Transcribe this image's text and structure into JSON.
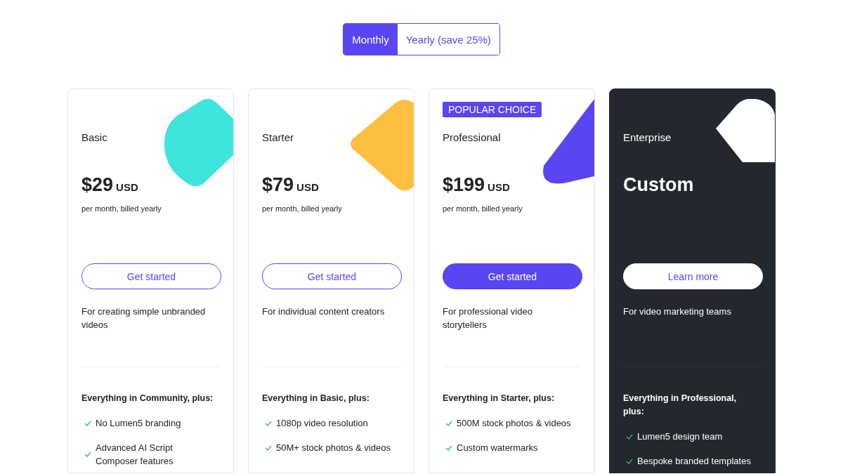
{
  "billing_toggle": [
    {
      "label": "Monthly",
      "selected": true
    },
    {
      "label": "Yearly (save 25%)",
      "selected": false
    }
  ],
  "plans": [
    {
      "name": "Basic",
      "kind": "light",
      "color": "#3de5dc",
      "price": "$29",
      "currency": "USD",
      "note": "per month, billed yearly",
      "button": {
        "label": "Get started",
        "kind": "outline"
      },
      "description": "For creating simple unbranded videos",
      "features_heading": "Everything in Community, plus:",
      "features": [
        "No Lumen5 branding",
        "Advanced AI Script Composer features"
      ]
    },
    {
      "name": "Starter",
      "kind": "light",
      "color": "#fdbf40",
      "price": "$79",
      "currency": "USD",
      "note": "per month, billed yearly",
      "button": {
        "label": "Get started",
        "kind": "outline"
      },
      "description": "For individual content creators",
      "features_heading": "Everything in Basic, plus:",
      "features": [
        "1080p video resolution",
        "50M+ stock photos & videos"
      ]
    },
    {
      "name": "Professional",
      "badge": "POPULAR CHOICE",
      "kind": "light",
      "color": "#5a45f2",
      "price": "$199",
      "currency": "USD",
      "note": "per month, billed yearly",
      "button": {
        "label": "Get started",
        "kind": "filled"
      },
      "description": "For professional video storytellers",
      "features_heading": "Everything in Starter, plus:",
      "features": [
        "500M stock photos & videos",
        "Custom watermarks"
      ]
    },
    {
      "name": "Enterprise",
      "kind": "dark",
      "color": "#ffffff",
      "price": "Custom",
      "button": {
        "label": "Learn more",
        "kind": "white"
      },
      "description": "For video marketing teams",
      "features_heading": "Everything in Professional, plus:",
      "features": [
        "Lumen5 design team",
        "Bespoke branded templates"
      ]
    }
  ]
}
